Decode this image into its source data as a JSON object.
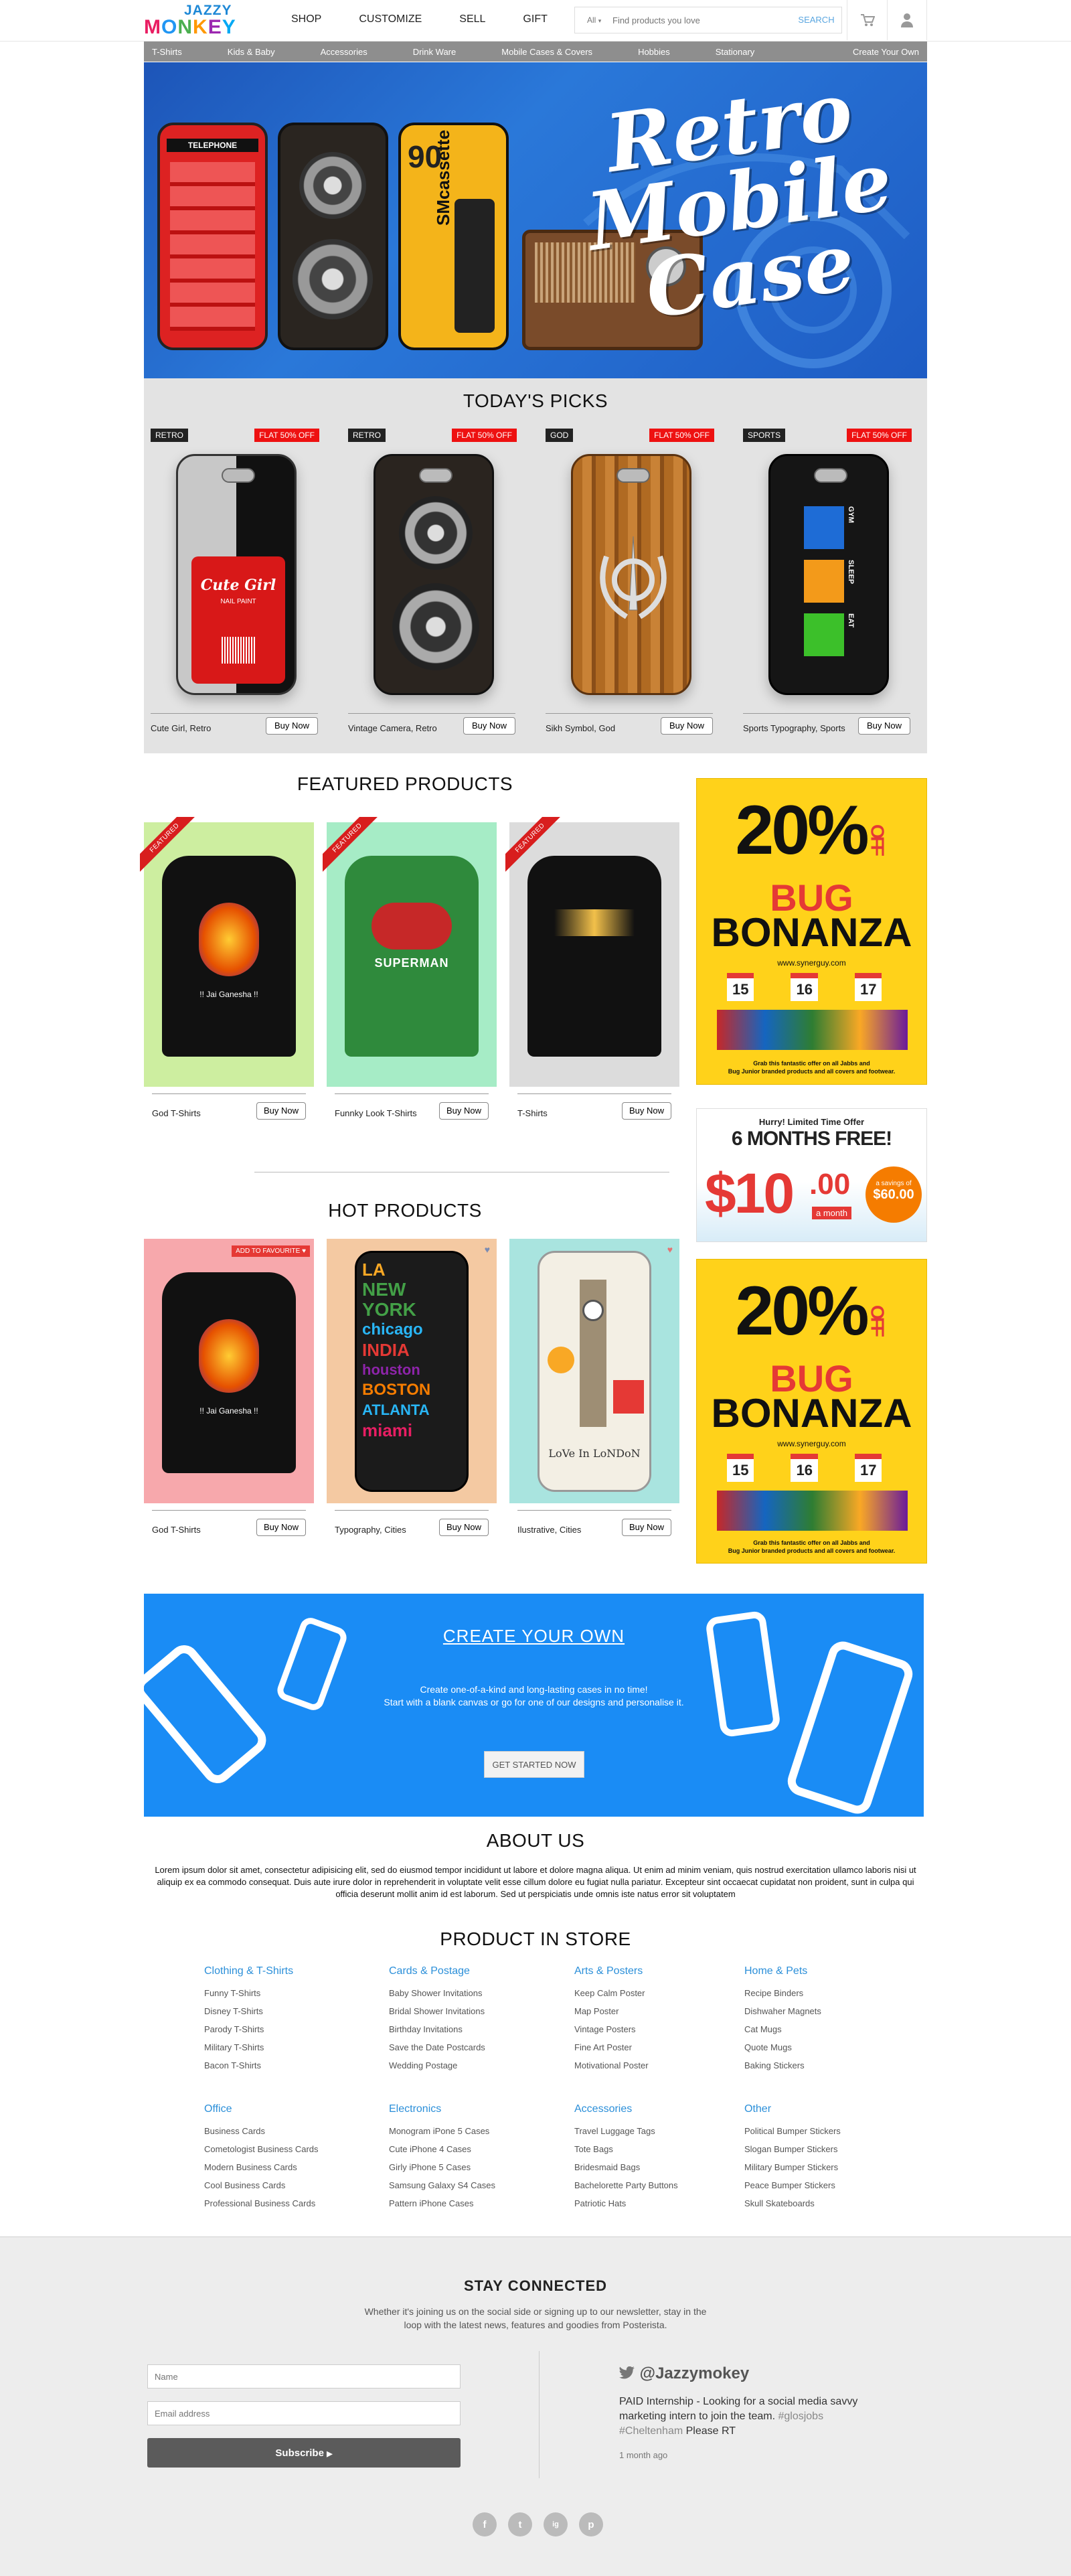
{
  "header": {
    "logo_top": "JAZZY",
    "logo_bottom": "MONKEY",
    "nav": [
      "SHOP",
      "CUSTOMIZE",
      "SELL",
      "GIFT"
    ],
    "search": {
      "scope": "All",
      "placeholder": "Find products you love",
      "button": "SEARCH"
    }
  },
  "categories": [
    "T-Shirts",
    "Kids & Baby",
    "Accessories",
    "Drink Ware",
    "Mobile Cases & Covers",
    "Hobbies",
    "Stationary"
  ],
  "categories_right": "Create Your Own",
  "hero": {
    "line1": "Retro",
    "line2": "Mobile",
    "line3": "Case",
    "cassette_text": "SMcassette",
    "phone_text": "TELEPHONE",
    "cassette_num": "90"
  },
  "picks": {
    "title": "TODAY'S PICKS",
    "items": [
      {
        "tag": "RETRO",
        "offer": "FLAT 50% OFF",
        "label": "Cute Girl, Retro",
        "button": "Buy Now",
        "art_line1": "Cute Girl",
        "art_line2": "NAIL PAINT"
      },
      {
        "tag": "RETRO",
        "offer": "FLAT 50% OFF",
        "label": "Vintage Camera, Retro",
        "button": "Buy Now"
      },
      {
        "tag": "GOD",
        "offer": "FLAT 50% OFF",
        "label": "Sikh Symbol, God",
        "button": "Buy Now"
      },
      {
        "tag": "SPORTS",
        "offer": "FLAT 50% OFF",
        "label": "Sports Typography, Sports",
        "button": "Buy Now",
        "art_words": [
          "GYM",
          "SLEEP",
          "EAT"
        ]
      }
    ]
  },
  "featured": {
    "title": "FEATURED PRODUCTS",
    "ribbon": "FEATURED",
    "items": [
      {
        "label": "God T-Shirts",
        "button": "Buy Now",
        "art": "!! Jai Ganesha !!",
        "bg": "#cdeea0"
      },
      {
        "label": "Funnky Look T-Shirts",
        "button": "Buy Now",
        "art": "SUPERMAN",
        "bg": "#a6ecc6"
      },
      {
        "label": "T-Shirts",
        "button": "Buy Now",
        "art": "",
        "bg": "#dcdcdc"
      }
    ]
  },
  "ad1": {
    "percent": "20%",
    "off": "OFF",
    "line1": "BUG",
    "line2": "BONANZA",
    "site": "www.synerguy.com",
    "fine1": "Grab this fantastic offer on all Jabbs and",
    "fine2": "Bug Junior branded products and all covers and footwear.",
    "days": [
      "15",
      "16",
      "17"
    ]
  },
  "ad2": {
    "hurry": "Hurry! Limited Time Offer",
    "months": "6 MONTHS FREE!",
    "price": "$10",
    "cents": ".00",
    "per": "a month",
    "savings_label": "a savings of",
    "savings": "$60.00"
  },
  "ad3": {
    "percent": "20%",
    "off": "OFF",
    "line1": "BUG",
    "line2": "BONANZA",
    "site": "www.synerguy.com",
    "fine1": "Grab this fantastic offer on all Jabbs and",
    "fine2": "Bug Junior branded products and all covers and footwear.",
    "days": [
      "15",
      "16",
      "17"
    ]
  },
  "hot": {
    "title": "HOT PRODUCTS",
    "fav": "ADD TO FAVOURITE",
    "items": [
      {
        "label": "God T-Shirts",
        "button": "Buy Now",
        "art": "!! Jai Ganesha !!",
        "bg": "#f7a8ac"
      },
      {
        "label": "Typography, Cities",
        "button": "Buy Now",
        "art_words": [
          "LA",
          "NEW YORK",
          "chicago",
          "INDIA",
          "houston",
          "BOSTON",
          "ATLANTA",
          "miami"
        ],
        "bg": "#f4c9a2"
      },
      {
        "label": "Ilustrative, Cities",
        "button": "Buy Now",
        "art": "LoVe In LoNDoN",
        "bg": "#a9e4df"
      }
    ]
  },
  "create": {
    "title": "CREATE YOUR OWN",
    "line1": "Create one-of-a-kind and long-lasting cases in no time!",
    "line2": "Start with a blank canvas or go for one of our designs and personalise it.",
    "button": "GET STARTED NOW"
  },
  "about": {
    "title": "ABOUT US",
    "text": "Lorem ipsum dolor sit amet, consectetur adipisicing elit, sed do eiusmod tempor incididunt ut labore et dolore magna aliqua. Ut enim ad minim veniam, quis nostrud exercitation ullamco laboris nisi ut aliquip ex ea commodo consequat. Duis aute irure dolor in reprehenderit in voluptate velit esse cillum dolore eu fugiat nulla pariatur. Excepteur sint occaecat cupidatat non proident, sunt in culpa qui officia deserunt mollit anim id est laborum. Sed ut perspiciatis unde omnis iste natus error sit voluptatem"
  },
  "store": {
    "title": "PRODUCT IN STORE",
    "columns": [
      {
        "heading": "Clothing & T-Shirts",
        "links": [
          "Funny T-Shirts",
          "Disney T-Shirts",
          "Parody T-Shirts",
          "Military T-Shirts",
          "Bacon T-Shirts"
        ]
      },
      {
        "heading": "Cards & Postage",
        "links": [
          "Baby Shower Invitations",
          "Bridal Shower Invitations",
          "Birthday Invitations",
          "Save the Date Postcards",
          "Wedding Postage"
        ]
      },
      {
        "heading": "Arts & Posters",
        "links": [
          "Keep Calm Poster",
          "Map Poster",
          "Vintage Posters",
          "Fine Art Poster",
          "Motivational Poster"
        ]
      },
      {
        "heading": "Home & Pets",
        "links": [
          "Recipe Binders",
          "Dishwaher Magnets",
          "Cat Mugs",
          "Quote Mugs",
          "Baking Stickers"
        ]
      },
      {
        "heading": "Office",
        "links": [
          "Business Cards",
          "Cometologist Business Cards",
          "Modern Business Cards",
          "Cool Business Cards",
          "Professional Business Cards"
        ]
      },
      {
        "heading": "Electronics",
        "links": [
          "Monogram iPone 5 Cases",
          "Cute iPhone 4 Cases",
          "Girly iPhone 5 Cases",
          "Samsung Galaxy S4 Cases",
          "Pattern iPhone Cases"
        ]
      },
      {
        "heading": "Accessories",
        "links": [
          "Travel Luggage Tags",
          "Tote Bags",
          "Bridesmaid Bags",
          "Bachelorette Party Buttons",
          "Patriotic Hats"
        ]
      },
      {
        "heading": "Other",
        "links": [
          "Political Bumper Stickers",
          "Slogan Bumper Stickers",
          "Military Bumper Stickers",
          "Peace Bumper Stickers",
          "Skull Skateboards"
        ]
      }
    ]
  },
  "footer": {
    "title": "STAY CONNECTED",
    "line1": "Whether it's joining us on the social side or signing up to our newsletter, stay in the",
    "line2": "loop with the latest news, features and goodies from Posterista.",
    "name_placeholder": "Name",
    "email_placeholder": "Email address",
    "subscribe": "Subscribe",
    "handle": "@Jazzymokey",
    "tweet1": "PAID Internship - Looking for a social media savvy",
    "tweet2": "marketing intern to join the team.",
    "tweet_tag1": "#glosjobs",
    "tweet_tag2": "#Cheltenham",
    "tweet3": "Please RT",
    "tweet_time": "1 month ago",
    "social": [
      "f",
      "t",
      "ig",
      "p"
    ]
  }
}
